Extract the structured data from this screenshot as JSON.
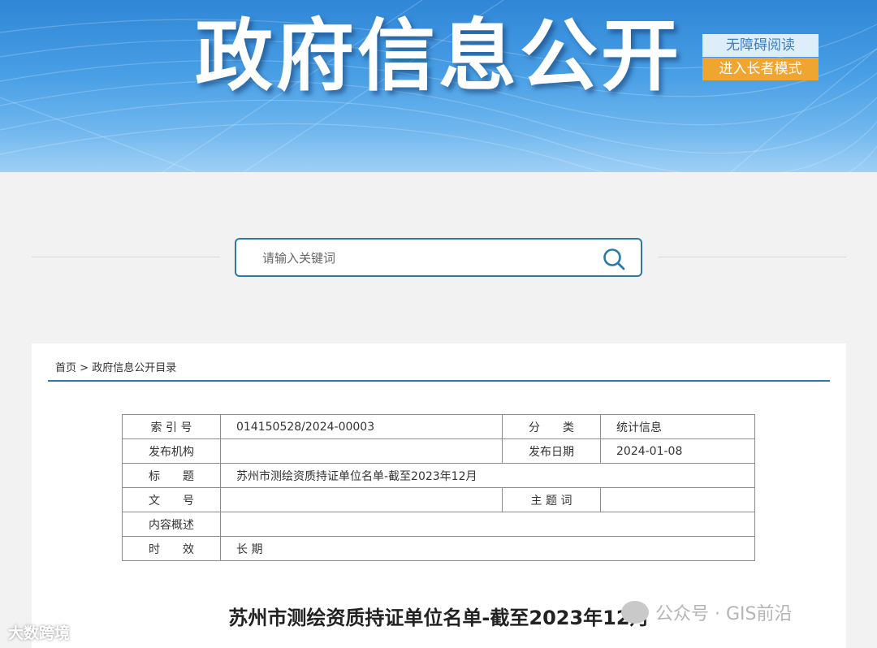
{
  "banner": {
    "title": "政府信息公开",
    "accessible_label": "无障碍阅读",
    "elder_label": "进入长者模式"
  },
  "search": {
    "placeholder": "请输入关键词"
  },
  "breadcrumb": {
    "home": "首页",
    "separator": ">",
    "current": "政府信息公开目录"
  },
  "meta": {
    "index_label": "索 引 号",
    "index_value": "014150528/2024-00003",
    "category_label": "分　　类",
    "category_value": "统计信息",
    "publisher_label": "发布机构",
    "publisher_value": "",
    "date_label": "发布日期",
    "date_value": "2024-01-08",
    "title_label": "标　　题",
    "title_value": "苏州市测绘资质持证单位名单-截至2023年12月",
    "docno_label": "文　　号",
    "docno_value": "",
    "keyword_label": "主 题 词",
    "keyword_value": "",
    "summary_label": "内容概述",
    "summary_value": "",
    "validity_label": "时　　效",
    "validity_value": "长 期"
  },
  "document": {
    "title": "苏州市测绘资质持证单位名单-截至2023年12月"
  },
  "watermarks": {
    "left": "大数跨境",
    "right": "公众号 · GIS前沿"
  },
  "colors": {
    "accent": "#2c7aa8",
    "elder": "#f0a531",
    "banner": "#3f93dd"
  }
}
